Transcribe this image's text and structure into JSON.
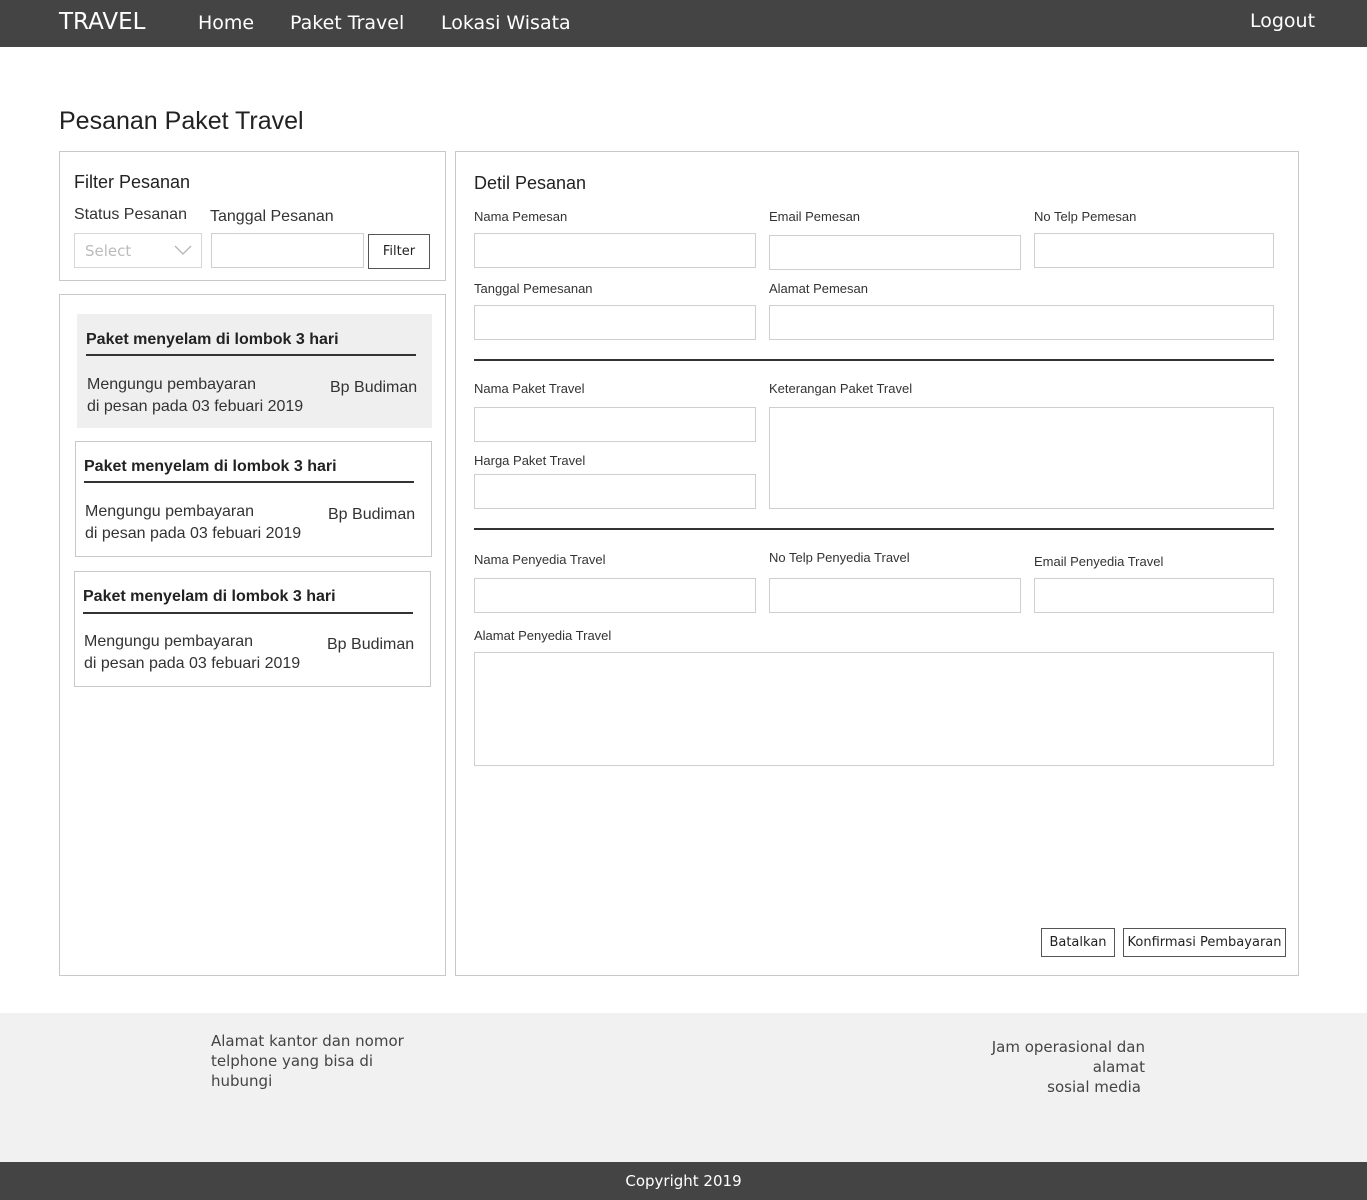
{
  "navbar": {
    "brand": "TRAVEL",
    "links": [
      "Home",
      "Paket Travel",
      "Lokasi Wisata"
    ],
    "logout": "Logout"
  },
  "page_title": "Pesanan Paket Travel",
  "filter": {
    "title": "Filter Pesanan",
    "status_label": "Status Pesanan",
    "status_placeholder": "Select",
    "date_label": "Tanggal Pesanan",
    "date_value": "",
    "button": "Filter"
  },
  "orders": [
    {
      "title": "Paket menyelam di lombok 3 hari",
      "status": "Mengungu pembayaran",
      "date": "di pesan pada 03 febuari 2019",
      "customer": "Bp Budiman",
      "selected": true
    },
    {
      "title": "Paket menyelam di lombok 3 hari",
      "status": "Mengungu pembayaran",
      "date": "di pesan pada 03 febuari 2019",
      "customer": "Bp Budiman",
      "selected": false
    },
    {
      "title": "Paket menyelam di lombok 3 hari",
      "status": "Mengungu pembayaran",
      "date": "di pesan pada 03 febuari 2019",
      "customer": "Bp Budiman",
      "selected": false
    }
  ],
  "detail": {
    "title": "Detil Pesanan",
    "fields": {
      "nama_pemesan": "Nama Pemesan",
      "email_pemesan": "Email Pemesan",
      "telp_pemesan": "No Telp Pemesan",
      "tanggal_pemesanan": "Tanggal Pemesanan",
      "alamat_pemesan": "Alamat Pemesan",
      "nama_paket": "Nama Paket Travel",
      "keterangan_paket": "Keterangan Paket Travel",
      "harga_paket": "Harga Paket Travel",
      "nama_penyedia": "Nama Penyedia Travel",
      "telp_penyedia": "No Telp Penyedia Travel",
      "email_penyedia": "Email Penyedia Travel",
      "alamat_penyedia": "Alamat Penyedia Travel"
    },
    "buttons": {
      "cancel": "Batalkan",
      "confirm": "Konfirmasi Pembayaran"
    }
  },
  "footer": {
    "left_lines": [
      "Alamat kantor dan nomor",
      "telphone yang bisa di",
      "hubungi"
    ],
    "right_lines": [
      "Jam operasional dan alamat",
      "sosial media"
    ],
    "copyright": "Copyright 2019"
  },
  "colors": {
    "navbar_bg": "#444444",
    "footer_bg": "#f1f1f1",
    "selected_card_bg": "#efefef"
  }
}
